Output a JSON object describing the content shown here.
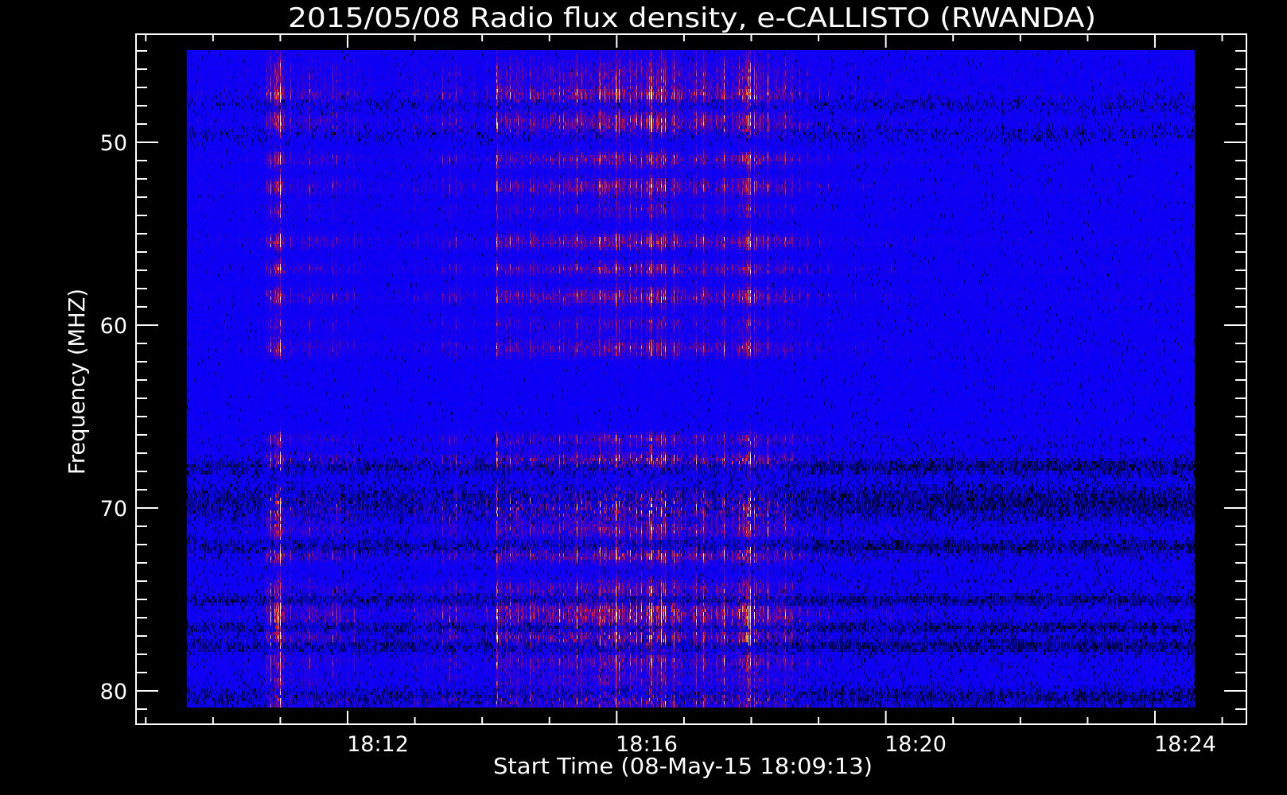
{
  "chart_data": {
    "type": "heatmap",
    "title": "2015/05/08  Radio flux density, e-CALLISTO (RWANDA)",
    "xlabel": "Start Time (08-May-15 18:09:13)",
    "ylabel": "Frequency (MHZ)",
    "x_ticks": [
      {
        "label": "18:12",
        "minute": 12
      },
      {
        "label": "18:16",
        "minute": 16
      },
      {
        "label": "18:20",
        "minute": 20
      },
      {
        "label": "18:24",
        "minute": 24
      }
    ],
    "y_ticks": [
      {
        "label": "50",
        "value": 50
      },
      {
        "label": "60",
        "value": 60
      },
      {
        "label": "70",
        "value": 70
      },
      {
        "label": "80",
        "value": 80
      }
    ],
    "x_axis_hour": 18,
    "xlim_minutes": [
      8.85,
      25.35
    ],
    "data_x_range_minutes": [
      9.61,
      24.58
    ],
    "ylim_mhz": [
      44.1,
      81.8
    ],
    "data_y_range_mhz": [
      45,
      81
    ],
    "y_inverted": true,
    "x_minor_step_minutes": 1,
    "y_minor_step_mhz": 1,
    "grid": false,
    "colormap": [
      "#000000",
      "#0000ff",
      "#7800a0",
      "#dc1414",
      "#ff6e00",
      "#ffe63c"
    ],
    "activity_peaks_minutes": [
      10.95,
      11.5,
      15.0,
      16.0,
      17.5
    ],
    "bright_bands_mhz": [
      46.5,
      49,
      51,
      52.5,
      55.5,
      57,
      58.5,
      61.3,
      67.5,
      70,
      72.6,
      75.5,
      77.2,
      80.5
    ],
    "dark_bands_mhz": [
      67.8,
      69.8,
      72.2,
      75,
      76.5,
      77.6,
      80.5
    ]
  },
  "colors": {
    "background": "#000000",
    "axes": "#ffffff"
  }
}
